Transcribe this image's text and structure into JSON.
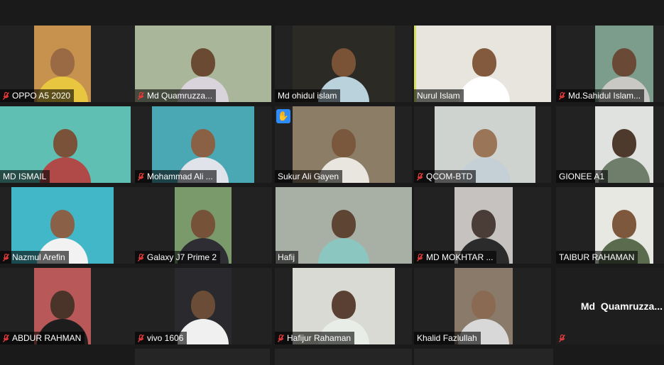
{
  "meeting": {
    "tiles": [
      {
        "name": "OPPO A5 2020",
        "muted": true,
        "active": false,
        "hand": false,
        "bg": "#c7924e",
        "skin": "#9a6a44",
        "shirt": "#e8c640"
      },
      {
        "name": "Md Quamruzza...",
        "muted": true,
        "active": false,
        "hand": false,
        "bg": "#a9b69a",
        "skin": "#6b4a33",
        "shirt": "#d9d4dc"
      },
      {
        "name": "Md ohidul islam",
        "muted": false,
        "active": false,
        "hand": false,
        "bg": "#2b2a25",
        "skin": "#7a5236",
        "shirt": "#b9d2dc"
      },
      {
        "name": "Nurul Islam",
        "muted": false,
        "active": true,
        "hand": false,
        "bg": "#e7e5dd",
        "skin": "#835a3d",
        "shirt": "#ffffff"
      },
      {
        "name": "Md.Sahidul Islam...",
        "muted": true,
        "active": false,
        "hand": false,
        "bg": "#7c9c8c",
        "skin": "#6a4a36",
        "shirt": "#c9c8c4"
      },
      {
        "name": "MD ISMAIL",
        "muted": false,
        "active": false,
        "hand": false,
        "bg": "#5fbfb2",
        "skin": "#7a5139",
        "shirt": "#b04a48"
      },
      {
        "name": "Mohammad Ali ...",
        "muted": true,
        "active": false,
        "hand": false,
        "bg": "#4aa7b4",
        "skin": "#8a6145",
        "shirt": "#e0e4ea"
      },
      {
        "name": "Sukur Ali Gayen",
        "muted": false,
        "active": false,
        "hand": true,
        "bg": "#8c7e66",
        "skin": "#7a583e",
        "shirt": "#e9e6df"
      },
      {
        "name": "QCOM-BTD",
        "muted": true,
        "active": false,
        "hand": false,
        "bg": "#cfd3cf",
        "skin": "#9a7558",
        "shirt": "#c5cfd6"
      },
      {
        "name": "GIONEE A1",
        "muted": false,
        "active": false,
        "hand": false,
        "bg": "#dfe2df",
        "skin": "#4e3a2d",
        "shirt": "#6f7d6b"
      },
      {
        "name": "Nazmul Arefin",
        "muted": true,
        "active": false,
        "hand": false,
        "bg": "#41b7c8",
        "skin": "#8a6147",
        "shirt": "#f2f2f2"
      },
      {
        "name": "Galaxy J7 Prime 2",
        "muted": true,
        "active": false,
        "hand": false,
        "bg": "#7b9a6c",
        "skin": "#755238",
        "shirt": "#2e2d33"
      },
      {
        "name": "Hafij",
        "muted": false,
        "active": false,
        "hand": false,
        "bg": "#a8b0a5",
        "skin": "#5e4433",
        "shirt": "#8bc7c0"
      },
      {
        "name": "MD MOKHTAR ...",
        "muted": true,
        "active": false,
        "hand": false,
        "bg": "#c6c2bf",
        "skin": "#4a3c36",
        "shirt": "#2b2b2b"
      },
      {
        "name": "TAIBUR RAHAMAN",
        "muted": false,
        "active": false,
        "hand": false,
        "bg": "#e7e8e2",
        "skin": "#7e583d",
        "shirt": "#5b6b4e"
      },
      {
        "name": "ABDUR RAHMAN",
        "muted": true,
        "active": false,
        "hand": false,
        "bg": "#b85858",
        "skin": "#4a3429",
        "shirt": "#1d1d1d"
      },
      {
        "name": "vivo 1606",
        "muted": true,
        "active": false,
        "hand": false,
        "bg": "#2a2a2e",
        "skin": "#6b4c37",
        "shirt": "#f0f0f0"
      },
      {
        "name": "Hafijur Rahaman",
        "muted": true,
        "active": false,
        "hand": false,
        "bg": "#d9dad3",
        "skin": "#5a4033",
        "shirt": "#e9ede8"
      },
      {
        "name": "Khalid Fazlullah",
        "muted": false,
        "active": false,
        "hand": false,
        "bg": "#8a7a6a",
        "skin": "#8a6a52",
        "shirt": "#d8d8d8"
      },
      {
        "name": "Md  Quamruzza...",
        "muted": true,
        "active": false,
        "hand": false,
        "nameOnly": true
      }
    ]
  },
  "colors": {
    "active_border": "#d6e25a",
    "muted_icon": "#e53b3b",
    "raise_hand": "#2d8cff"
  }
}
